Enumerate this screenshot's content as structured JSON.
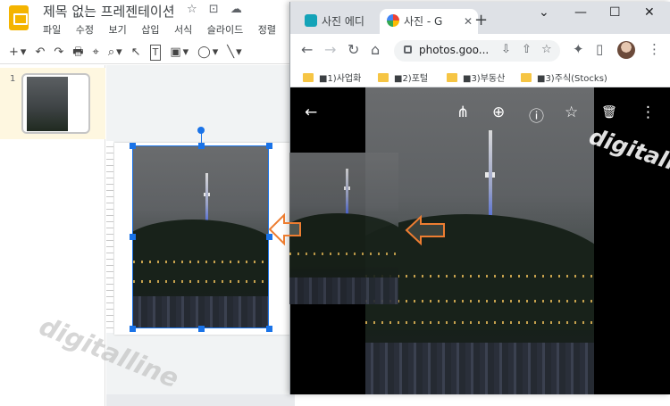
{
  "slides": {
    "doc_title": "제목 없는 프레젠테이션",
    "title_icons": [
      "☆",
      "⊡",
      "☁"
    ],
    "menu": [
      "파일",
      "수정",
      "보기",
      "삽입",
      "서식",
      "슬라이드",
      "정렬"
    ],
    "toolbar_icons": [
      "+",
      "▾",
      "↶",
      "↷",
      "🖶",
      "⌖",
      "⌕",
      "▾",
      "↖",
      "T",
      "▣",
      "▾",
      "◯",
      "▾",
      "╲",
      "▾"
    ],
    "slide_number": "1"
  },
  "chrome": {
    "tabs": [
      {
        "label": "사진 에디",
        "icon": "editor-icon"
      },
      {
        "label": "사진 - G",
        "icon": "google-photos-icon"
      }
    ],
    "new_tab": "+",
    "window_controls": [
      "⌄",
      "—",
      "☐",
      "✕"
    ],
    "nav": {
      "back": "←",
      "forward": "→",
      "reload": "↻",
      "home": "⌂"
    },
    "url": "photos.goo...",
    "omnibox_icons": [
      "⇩",
      "⇧",
      "☆"
    ],
    "extensions": [
      "✦",
      "▯",
      "⋮"
    ],
    "bookmarks": [
      {
        "label": "■1)사업화"
      },
      {
        "label": "■2)포털"
      },
      {
        "label": "■3)부동산"
      },
      {
        "label": "■3)주식(Stocks)"
      }
    ]
  },
  "viewer": {
    "back": "←",
    "actions": [
      {
        "name": "share-icon",
        "glyph": "⋔"
      },
      {
        "name": "zoom-in-icon",
        "glyph": "⊕"
      },
      {
        "name": "info-icon",
        "glyph": "ⓘ"
      },
      {
        "name": "favorite-icon",
        "glyph": "☆"
      },
      {
        "name": "delete-icon",
        "glyph": "🗑"
      },
      {
        "name": "more-icon",
        "glyph": "⋮"
      }
    ],
    "watermark": "digitalline"
  },
  "watermark_slide": "digitalline",
  "colors": {
    "selection": "#1a73e8",
    "arrow": "#ed7d31",
    "slides_brand": "#f4b400",
    "bookmark_folder": "#f6c544"
  }
}
